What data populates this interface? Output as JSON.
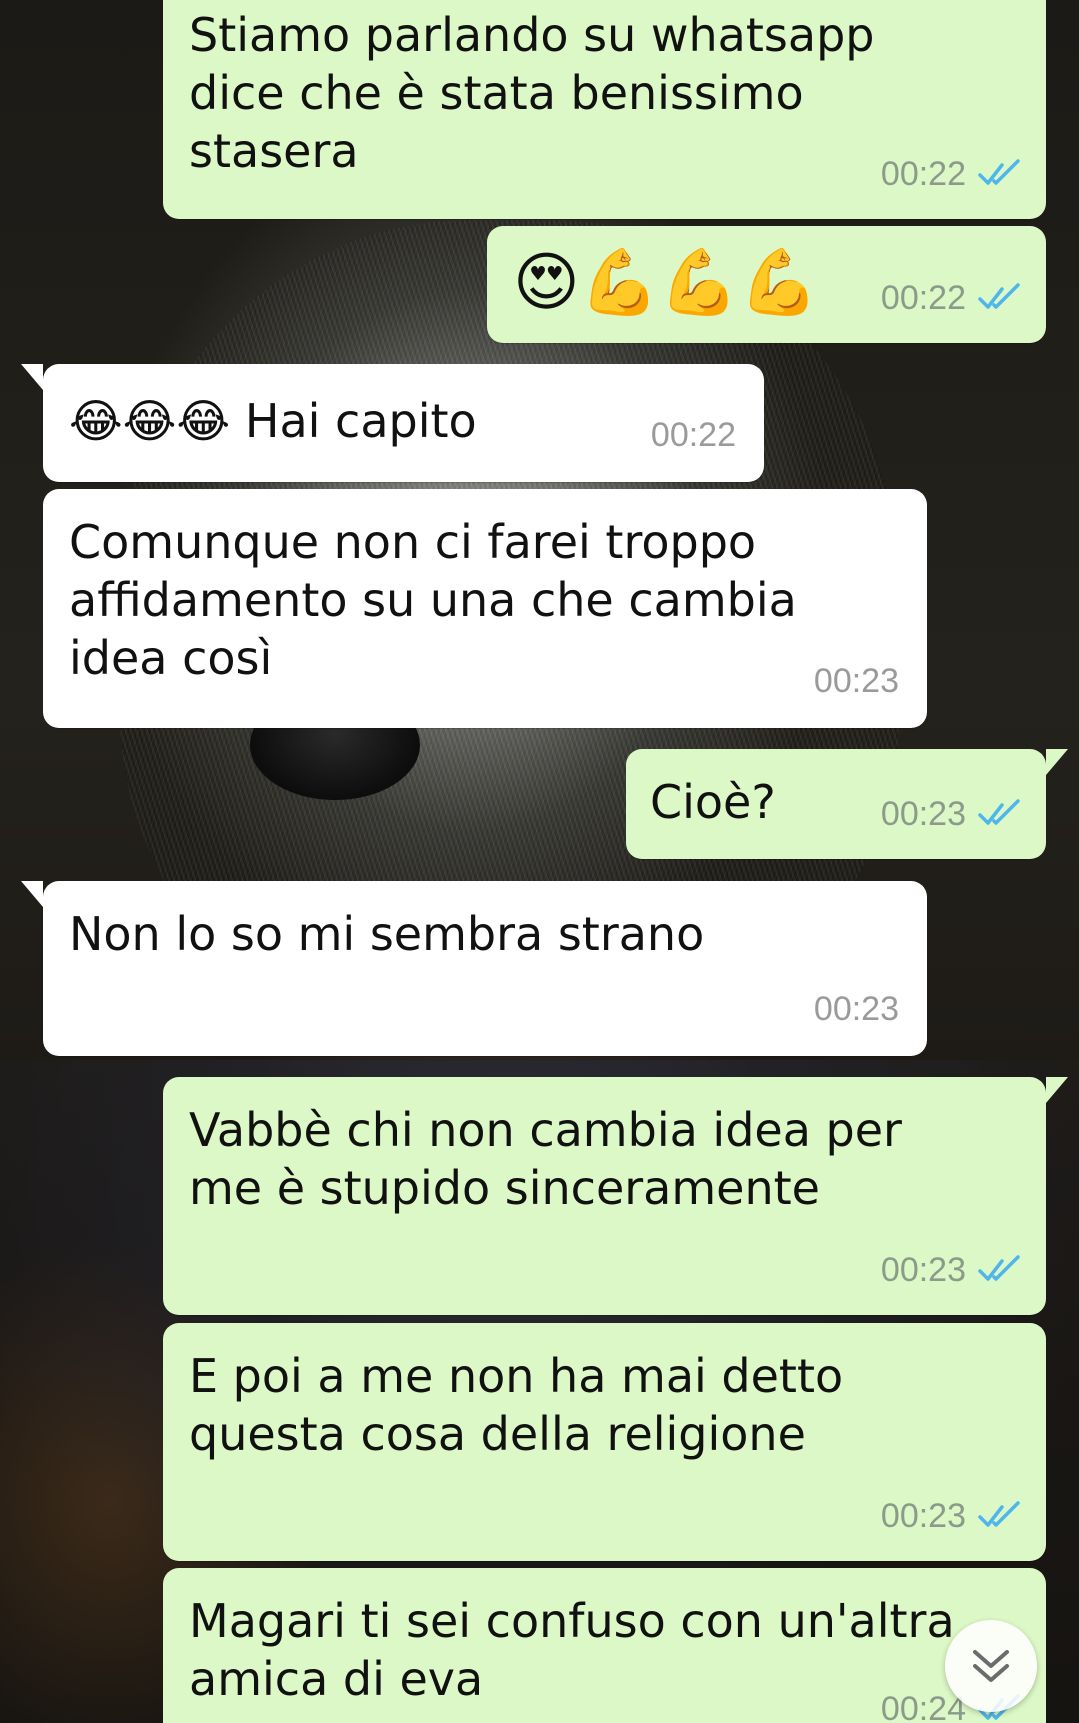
{
  "messages": [
    {
      "text": "Stiamo parlando su whatsapp\ndice che è stata benissimo\nstasera",
      "time": "00:22",
      "direction": "out"
    },
    {
      "text": "😍💪💪💪",
      "time": "00:22",
      "direction": "out"
    },
    {
      "text": "😂😂😂 Hai capito",
      "time": "00:22",
      "direction": "in"
    },
    {
      "text": "Comunque non ci farei troppo\naffidamento su una che cambia\nidea così",
      "time": "00:23",
      "direction": "in"
    },
    {
      "text": "Cioè?",
      "time": "00:23",
      "direction": "out"
    },
    {
      "text": "Non lo so mi sembra strano",
      "time": "00:23",
      "direction": "in"
    },
    {
      "text": "Vabbè chi non cambia idea per\nme è stupido sinceramente",
      "time": "00:23",
      "direction": "out"
    },
    {
      "text": "E poi a me non ha mai detto\nquesta cosa della religione",
      "time": "00:23",
      "direction": "out"
    },
    {
      "text": "Magari ti sei confuso con un'altra\namica di eva",
      "time": "00:24",
      "direction": "out"
    }
  ],
  "colors": {
    "outgoing_bubble": "#dcf8c6",
    "incoming_bubble": "#ffffff",
    "read_ticks": "#4fb6ec"
  },
  "icons": {
    "read_receipt": "double-check-icon",
    "scroll_down": "chevron-double-down-icon"
  }
}
